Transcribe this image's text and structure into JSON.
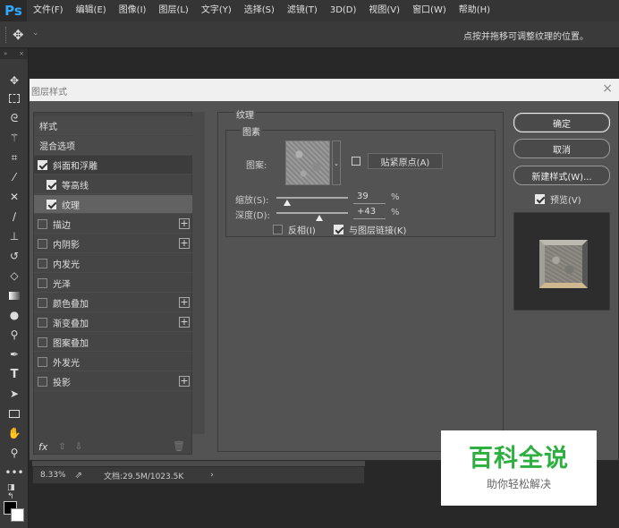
{
  "app": {
    "logo": "Ps"
  },
  "menu": [
    "文件(F)",
    "编辑(E)",
    "图像(I)",
    "图层(L)",
    "文字(Y)",
    "选择(S)",
    "滤镜(T)",
    "3D(D)",
    "视图(V)",
    "窗口(W)",
    "帮助(H)"
  ],
  "options_bar": {
    "hint": "点按并拖移可调整纹理的位置。"
  },
  "dialog": {
    "title": "图层样式",
    "close": "×",
    "styles": [
      {
        "label": "样式",
        "kind": "header"
      },
      {
        "label": "混合选项",
        "kind": "header"
      },
      {
        "label": "斜面和浮雕",
        "checked": true
      },
      {
        "label": "等高线",
        "checked": true,
        "indent": true
      },
      {
        "label": "纹理",
        "checked": true,
        "indent": true,
        "selected": true
      },
      {
        "label": "描边",
        "checked": false,
        "plus": true
      },
      {
        "label": "内阴影",
        "checked": false,
        "plus": true
      },
      {
        "label": "内发光",
        "checked": false
      },
      {
        "label": "光泽",
        "checked": false
      },
      {
        "label": "颜色叠加",
        "checked": false,
        "plus": true
      },
      {
        "label": "渐变叠加",
        "checked": false,
        "plus": true
      },
      {
        "label": "图案叠加",
        "checked": false
      },
      {
        "label": "外发光",
        "checked": false
      },
      {
        "label": "投影",
        "checked": false,
        "plus": true
      }
    ],
    "footer": {
      "fx": "fx",
      "up": "⇧",
      "down": "⇩",
      "trash": "🗑"
    },
    "texture": {
      "title": "纹理",
      "group_title": "图素",
      "pattern_label": "图案:",
      "snap_button": "贴紧原点(A)",
      "scale": {
        "label": "缩放(S):",
        "value": "39",
        "unit": "%",
        "level": 0.39
      },
      "depth": {
        "label": "深度(D):",
        "value": "+43",
        "unit": "%",
        "level": 0.6
      },
      "invert": {
        "label": "反相(I)",
        "checked": false
      },
      "link": {
        "label": "与图层链接(K)",
        "checked": true
      }
    },
    "buttons": {
      "ok": "确定",
      "cancel": "取消",
      "new_style": "新建样式(W)...",
      "preview": "预览(V)"
    }
  },
  "status": {
    "zoom": "8.33%",
    "doc": "文档:29.5M/1023.5K",
    "arrow": "›"
  },
  "watermark": {
    "title": "百科全说",
    "subtitle": "助你轻松解决"
  }
}
